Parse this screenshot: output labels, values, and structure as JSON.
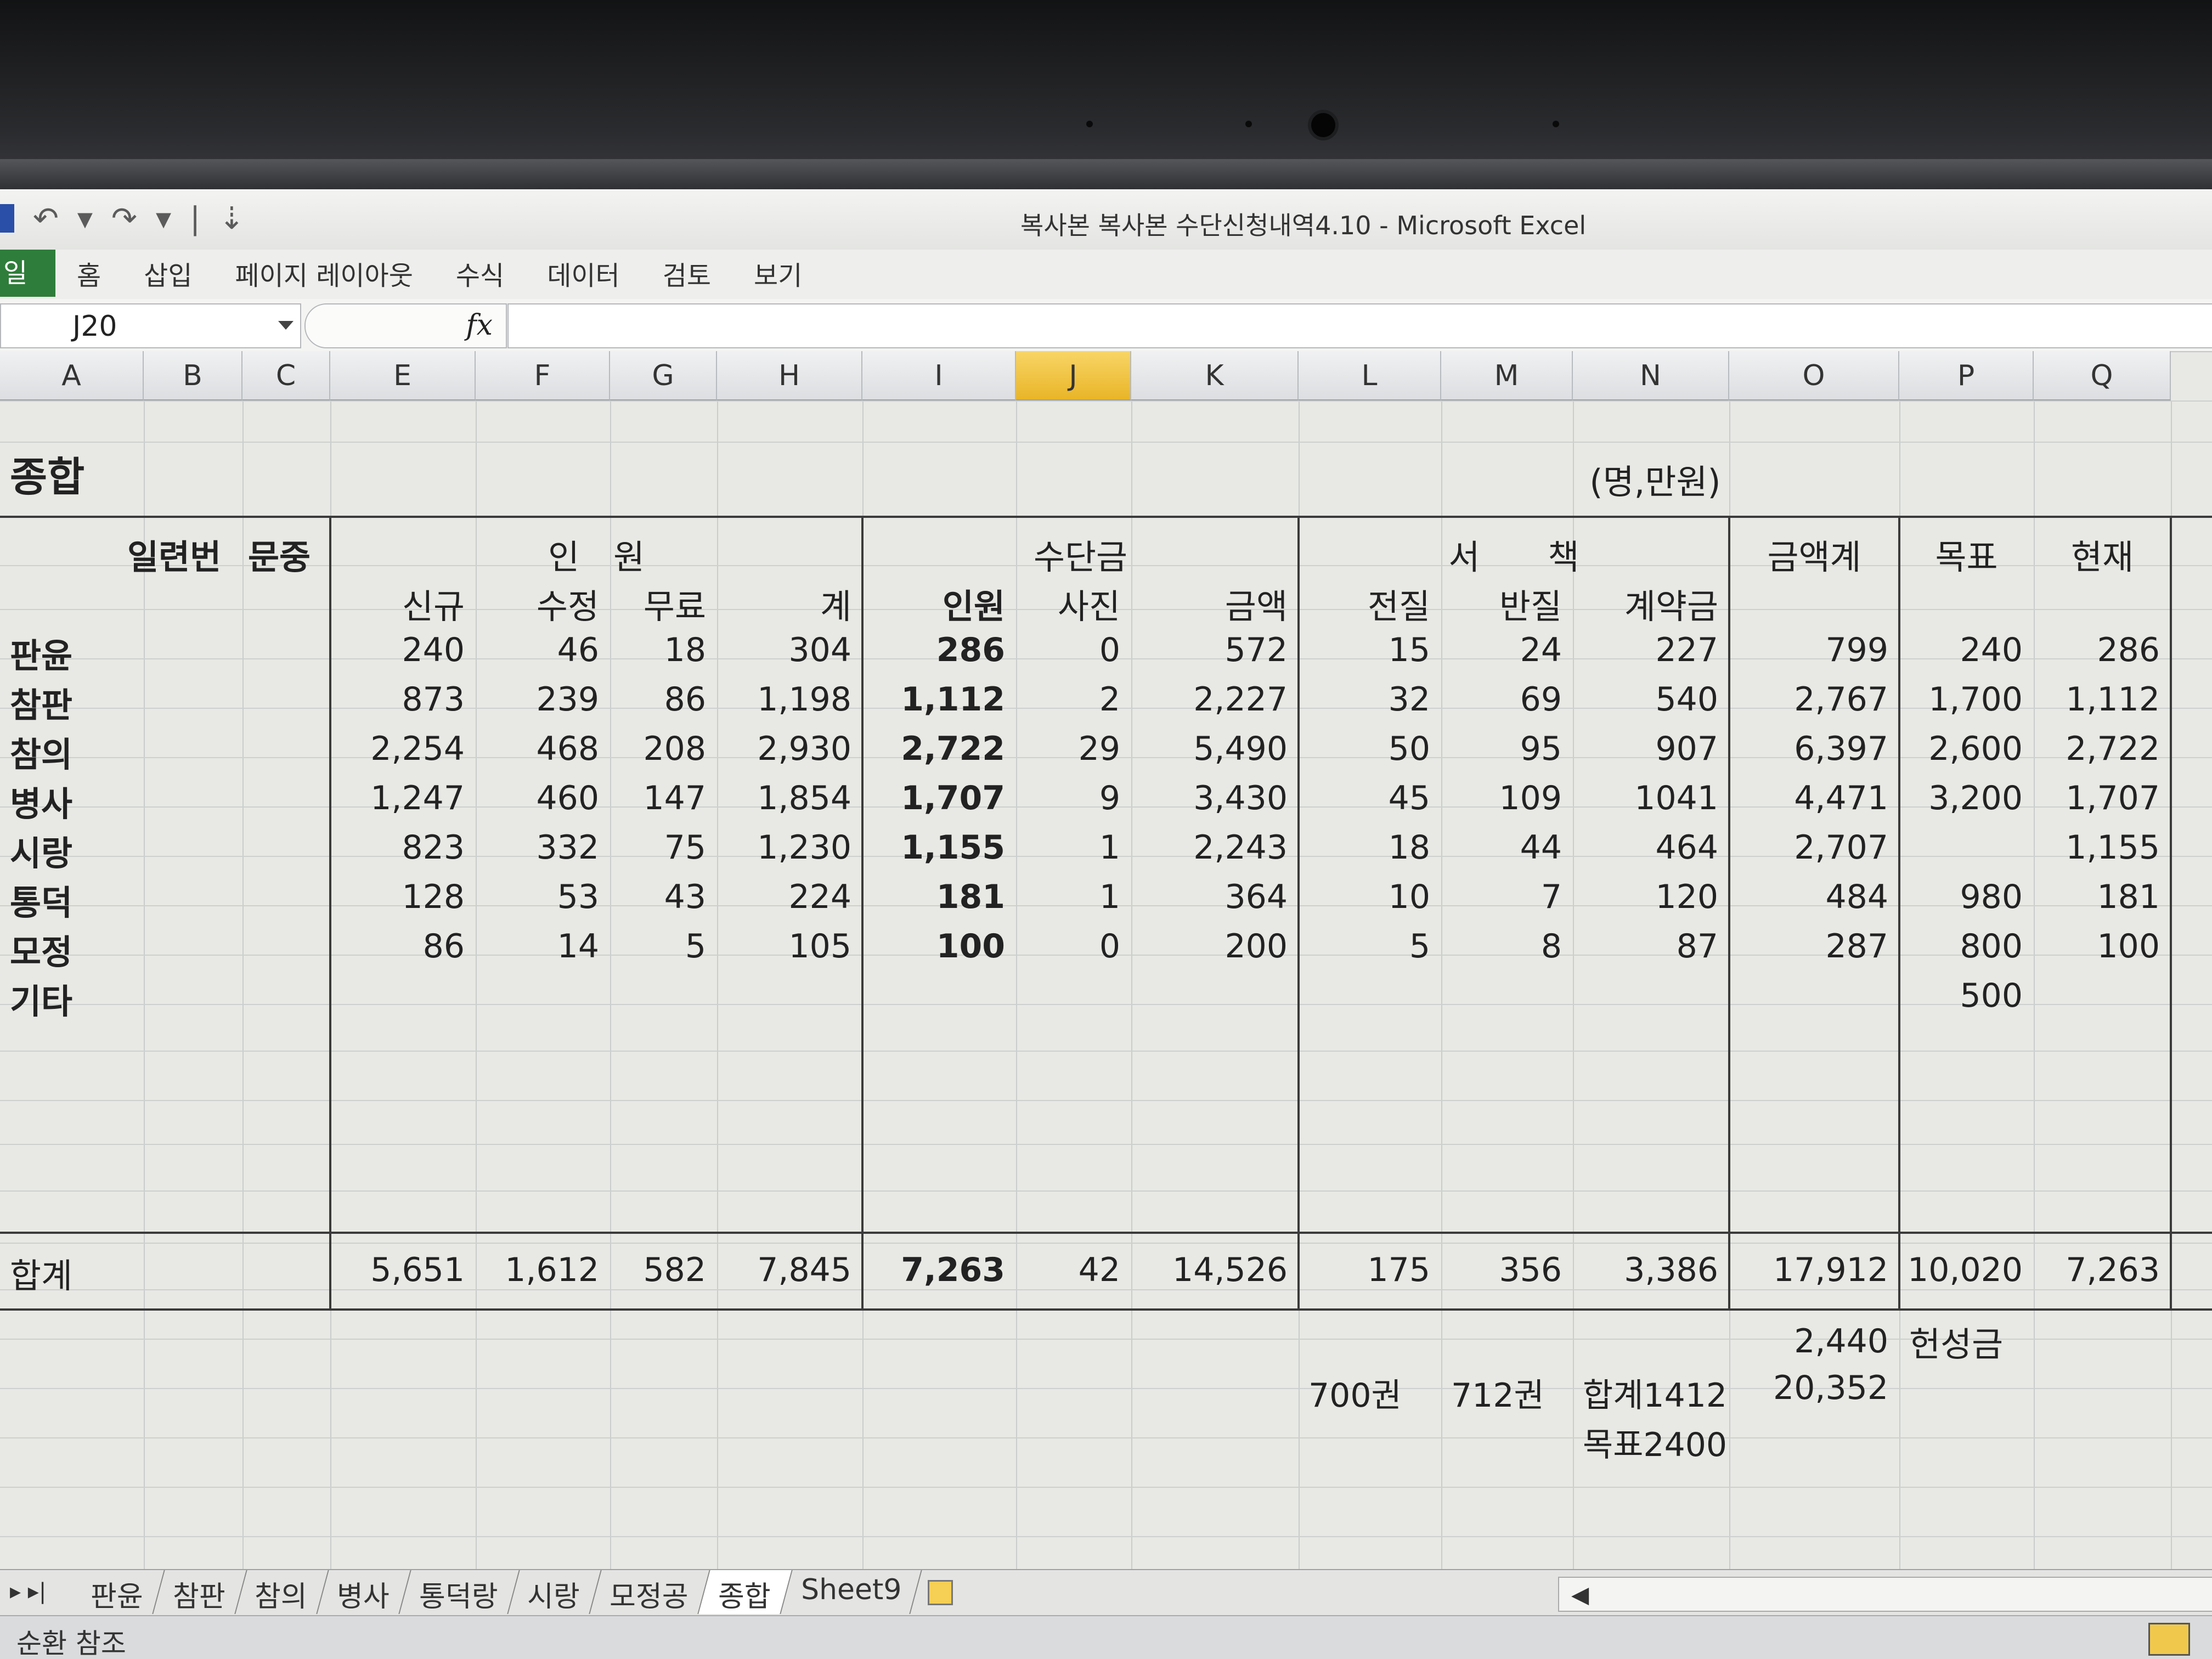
{
  "app": {
    "title": "복사본 복사본 수단신청내역4.10  -  Microsoft Excel",
    "qat": [
      "↶",
      "▾",
      "↷",
      "▾",
      "|",
      "⇣"
    ]
  },
  "ribbon": {
    "file": "일",
    "tabs": [
      "홈",
      "삽입",
      "페이지 레이아웃",
      "수식",
      "데이터",
      "검토",
      "보기"
    ]
  },
  "formula_bar": {
    "name_box": "J20",
    "fx": "fx",
    "value": ""
  },
  "columns": [
    "A",
    "B",
    "C",
    "E",
    "F",
    "G",
    "H",
    "I",
    "J",
    "K",
    "L",
    "M",
    "N",
    "O",
    "P",
    "Q"
  ],
  "selected_column": "J",
  "sheet": {
    "title": "종합",
    "unit": "(명,만원)",
    "group_headers": {
      "serial": "일련번",
      "type": "문중",
      "people": "인　원",
      "fee": "수단금",
      "books": "서　　책",
      "total_amount": "금액계",
      "target": "목표",
      "current": "현재"
    },
    "sub_headers": [
      "신규",
      "수정",
      "무료",
      "계",
      "인원",
      "사진",
      "금액",
      "전질",
      "반질",
      "계약금"
    ],
    "rows": [
      {
        "name": "판윤",
        "v": [
          "240",
          "46",
          "18",
          "304",
          "286",
          "0",
          "572",
          "15",
          "24",
          "227",
          "799",
          "240",
          "286"
        ]
      },
      {
        "name": "참판",
        "v": [
          "873",
          "239",
          "86",
          "1,198",
          "1,112",
          "2",
          "2,227",
          "32",
          "69",
          "540",
          "2,767",
          "1,700",
          "1,112"
        ]
      },
      {
        "name": "참의",
        "v": [
          "2,254",
          "468",
          "208",
          "2,930",
          "2,722",
          "29",
          "5,490",
          "50",
          "95",
          "907",
          "6,397",
          "2,600",
          "2,722"
        ]
      },
      {
        "name": "병사",
        "v": [
          "1,247",
          "460",
          "147",
          "1,854",
          "1,707",
          "9",
          "3,430",
          "45",
          "109",
          "1041",
          "4,471",
          "3,200",
          "1,707"
        ]
      },
      {
        "name": "시랑",
        "v": [
          "823",
          "332",
          "75",
          "1,230",
          "1,155",
          "1",
          "2,243",
          "18",
          "44",
          "464",
          "2,707",
          "",
          "1,155"
        ]
      },
      {
        "name": "통덕",
        "v": [
          "128",
          "53",
          "43",
          "224",
          "181",
          "1",
          "364",
          "10",
          "7",
          "120",
          "484",
          "980",
          "181"
        ]
      },
      {
        "name": "모정",
        "v": [
          "86",
          "14",
          "5",
          "105",
          "100",
          "0",
          "200",
          "5",
          "8",
          "87",
          "287",
          "800",
          "100"
        ]
      },
      {
        "name": "기타",
        "v": [
          "",
          "",
          "",
          "",
          "",
          "",
          "",
          "",
          "",
          "",
          "",
          "500",
          ""
        ]
      }
    ],
    "total": {
      "name": "합계",
      "v": [
        "5,651",
        "1,612",
        "582",
        "7,845",
        "7,263",
        "42",
        "14,526",
        "175",
        "356",
        "3,386",
        "17,912",
        "10,020",
        "7,263"
      ]
    },
    "extra": {
      "o_21": "2,440",
      "p_21": "헌성금",
      "l_22": "700권",
      "m_22": "712권",
      "n_22": "합계1412",
      "o_22": "20,352",
      "n_23": "목표2400"
    }
  },
  "sheet_tabs": [
    "판윤",
    "참판",
    "참의",
    "병사",
    "통덕랑",
    "시랑",
    "모정공",
    "종합",
    "Sheet9"
  ],
  "active_sheet": "종합",
  "status": "순환 참조"
}
